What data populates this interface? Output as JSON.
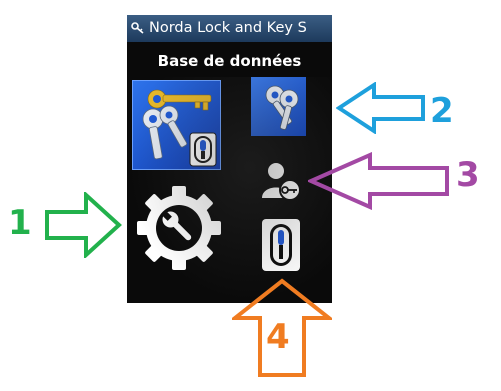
{
  "window": {
    "title": "Norda Lock and Key S"
  },
  "screen": {
    "subtitle": "Base de données"
  },
  "icons": {
    "keys_database": "keys-and-cylinder-icon",
    "keys": "keys-icon",
    "user_key": "user-key-icon",
    "settings": "gear-wrench-icon",
    "cylinder": "lock-cylinder-icon"
  },
  "callouts": [
    {
      "number": "1",
      "color": "#22b14c",
      "points_to": "settings"
    },
    {
      "number": "2",
      "color": "#1ea0dc",
      "points_to": "keys"
    },
    {
      "number": "3",
      "color": "#a349a4",
      "points_to": "user_key"
    },
    {
      "number": "4",
      "color": "#f07c21",
      "points_to": "cylinder"
    }
  ],
  "colors": {
    "titlebar": "#2a4a6e",
    "tile_blue": "#1f5ad8",
    "background": "#0a0a0a"
  }
}
